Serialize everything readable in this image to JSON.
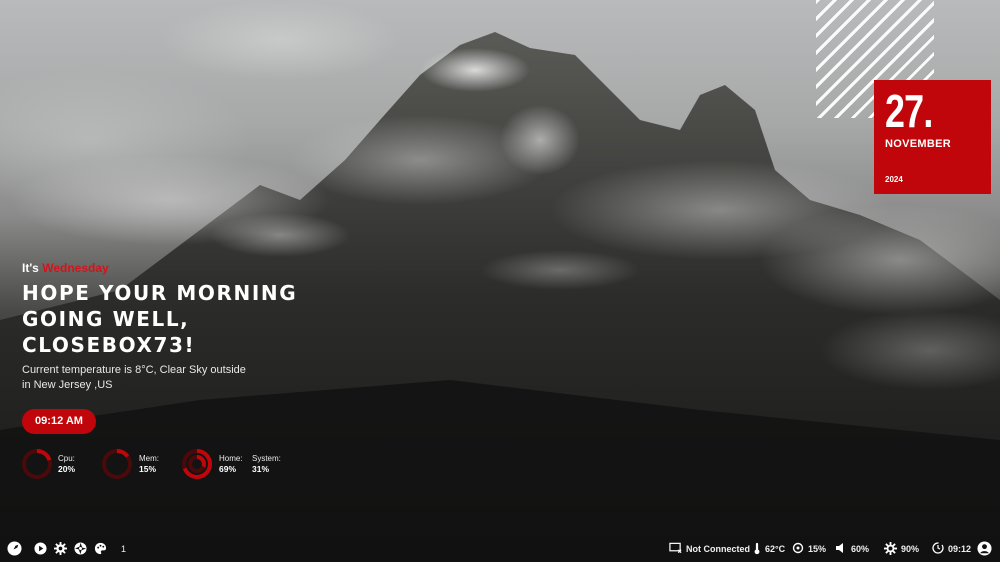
{
  "date_card": {
    "day": "27.",
    "month": "NOVEMBER",
    "year": "2024"
  },
  "greeting": {
    "prefix": "It's",
    "day": "Wednesday",
    "headline_lines": [
      "Hope your morning",
      "going well,",
      "closebox73!"
    ],
    "weather_line1": "Current temperature is 8°C, Clear Sky outside",
    "weather_line2": "in New Jersey ,US"
  },
  "time_pill": "09:12 AM",
  "gauges": [
    {
      "label": "Cpu:",
      "value": "20%",
      "fraction": 0.2
    },
    {
      "label": "Mem:",
      "value": "15%",
      "fraction": 0.15
    },
    {
      "label": "Home:",
      "value": "69%",
      "fraction": 0.69
    },
    {
      "label": "System:",
      "value": "31%",
      "fraction": 0.31
    }
  ],
  "taskbar": {
    "left_icons": [
      "rocket-icon",
      "play-icon",
      "gear-icon",
      "aperture-icon",
      "palette-icon"
    ],
    "workspace": "1",
    "network": "Not Connected",
    "temperature": "62°C",
    "cpu": "15%",
    "volume": "60%",
    "brightness": "90%",
    "clock": "09:12"
  },
  "colors": {
    "accent": "#c0060a",
    "accent_text": "#d4141a",
    "taskbar": "#111111"
  }
}
